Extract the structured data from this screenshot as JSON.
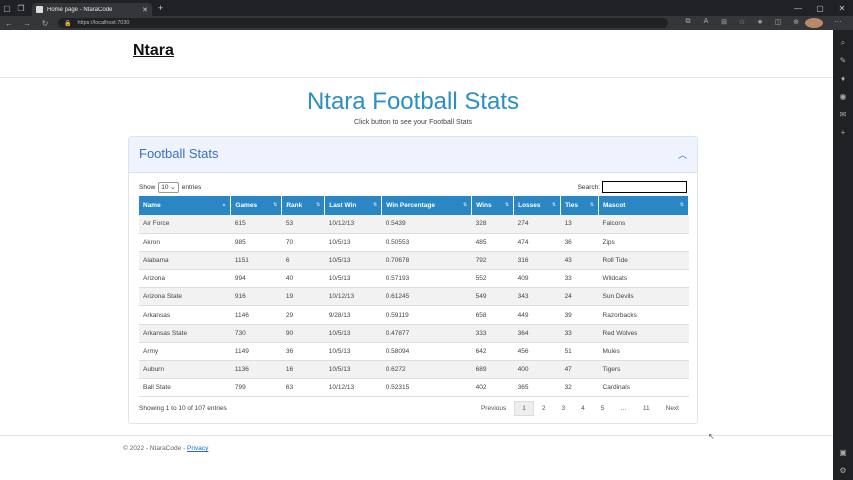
{
  "browser": {
    "tab_title": "Home page - NtaraCode",
    "url": "https://localhost:7030"
  },
  "navbar": {
    "brand": "Ntara"
  },
  "hero": {
    "title": "Ntara Football Stats",
    "subtitle": "Click button to see your Football Stats"
  },
  "card": {
    "title": "Football Stats"
  },
  "controls": {
    "show_label": "Show",
    "entries_value": "10",
    "entries_label": "entries",
    "search_label": "Search:",
    "search_value": ""
  },
  "table": {
    "headers": [
      "Name",
      "Games",
      "Rank",
      "Last Win",
      "Win Percentage",
      "Wins",
      "Losses",
      "Ties",
      "Mascot"
    ],
    "rows": [
      [
        "Air Force",
        "615",
        "53",
        "10/12/13",
        "0.5439",
        "328",
        "274",
        "13",
        "Falcons"
      ],
      [
        "Akron",
        "985",
        "70",
        "10/5/13",
        "0.50553",
        "485",
        "474",
        "36",
        "Zips"
      ],
      [
        "Alabama",
        "1151",
        "6",
        "10/5/13",
        "0.70678",
        "792",
        "316",
        "43",
        "Roll Tide"
      ],
      [
        "Arizona",
        "994",
        "40",
        "10/5/13",
        "0.57193",
        "552",
        "409",
        "33",
        "Wildcats"
      ],
      [
        "Arizona State",
        "916",
        "19",
        "10/12/13",
        "0.61245",
        "549",
        "343",
        "24",
        "Sun Devils"
      ],
      [
        "Arkansas",
        "1146",
        "29",
        "9/28/13",
        "0.59119",
        "658",
        "449",
        "39",
        "Razorbacks"
      ],
      [
        "Arkansas State",
        "730",
        "90",
        "10/5/13",
        "0.47877",
        "333",
        "364",
        "33",
        "Red Wolves"
      ],
      [
        "Army",
        "1149",
        "36",
        "10/5/13",
        "0.58094",
        "642",
        "456",
        "51",
        "Mules"
      ],
      [
        "Auburn",
        "1136",
        "16",
        "10/5/13",
        "0.6272",
        "689",
        "400",
        "47",
        "Tigers"
      ],
      [
        "Ball State",
        "799",
        "63",
        "10/12/13",
        "0.52315",
        "402",
        "365",
        "32",
        "Cardinals"
      ]
    ]
  },
  "info": "Showing 1 to 10 of 107 entries",
  "pager": [
    "Previous",
    "1",
    "2",
    "3",
    "4",
    "5",
    "…",
    "11",
    "Next"
  ],
  "footer": {
    "text": "© 2022 - NtaraCode - ",
    "privacy": "Privacy"
  }
}
